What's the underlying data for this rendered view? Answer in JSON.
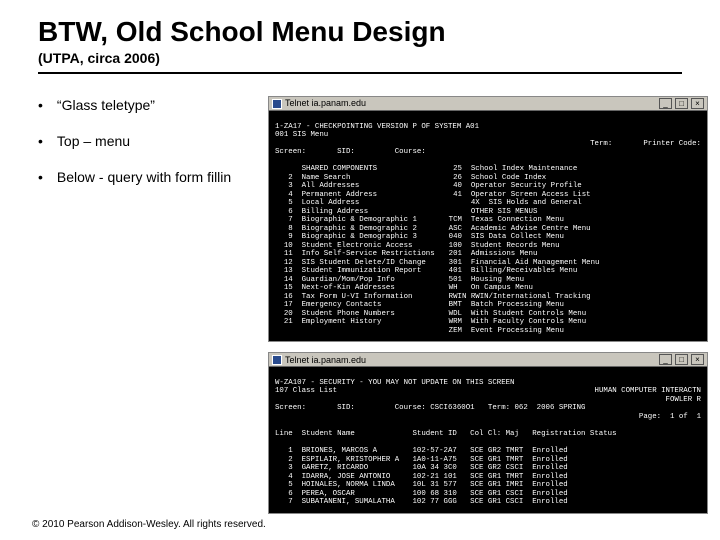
{
  "title": "BTW, Old School Menu Design",
  "subtitle": "(UTPA, circa 2006)",
  "bullets": [
    "“Glass teletype”",
    "Top – menu",
    "Below - query with form fillin"
  ],
  "telnet_title": "Telnet ia.panam.edu",
  "term1": {
    "line1": "1-ZA17 - CHECKPOINTING VERSION P OF SYSTEM A01",
    "line2": "001 SIS Menu",
    "line3r": "Term:       Printer Code:",
    "line4": "Screen:       SID:         Course:",
    "left_menu": "      SHARED COMPONENTS\n   2  Name Search\n   3  All Addresses\n   4  Permanent Address\n   5  Local Address\n   6  Billing Address\n   7  Biographic & Demographic 1\n   8  Biographic & Demographic 2\n   9  Biographic & Demographic 3\n  10  Student Electronic Access\n  11  Info Self-Service Restrictions\n  12  SIS Student Delete/ID Change\n  13  Student Immunization Report\n  14  Guardian/Mom/Pop Info\n  15  Next-of-Kin Addresses\n  16  Tax Form U-VI Information\n  17  Emergency Contacts\n  20  Student Phone Numbers\n  21  Employment History",
    "right_menu": " 25  School Index Maintenance\n 26  School Code Index\n 40  Operator Security Profile\n 41  Operator Screen Access List\n     4X  SIS Holds and General\n     OTHER SIS MENUS\nTCM  Texas Connection Menu\nASC  Academic Advise Centre Menu\n040  SIS Data Collect Menu\n100  Student Records Menu\n201  Admissions Menu\n301  Financial Aid Management Menu\n401  Billing/Receivables Menu\n501  Housing Menu\nWH   On Campus Menu\nRWIN RWIN/International Tracking\nBMT  Batch Processing Menu\nWDL  With Student Controls Menu\nWRM  With Faculty Controls Menu\nZEM  Event Processing Menu"
  },
  "term2": {
    "line1": "W-ZA107 - SECURITY - YOU MAY NOT UPDATE ON THIS SCREEN",
    "line2": "107 Class List",
    "line2r": "HUMAN COMPUTER INTERACTN",
    "line2r2": "FOWLER R",
    "line3": "Screen:       SID:         Course: CSCI6360O1   Term: 062  2006 SPRING",
    "line4r": "Page:  1 of  1",
    "cols": "Line  Student Name             Student ID   Col Cl: Maj   Registration Status",
    "rows": "   1  BRIONES, MARCOS A        102-57-2A7   SCE GR2 TMRT  Enrolled\n   2  ESPILAIR, KRISTOPHER A   1A0-11-A75   SCE GR1 TMRT  Enrolled\n   3  GARETZ, RICARDO          10A 34 3C0   SCE GR2 CSCI  Enrolled\n   4  IDARRA, JOSE ANTONIO     102-21 101   SCE GR1 TMRT  Enrolled\n   5  HOINALES, NORMA LINDA    10L 31 577   SCE GR1 IMRI  Enrolled\n   6  PEREA, OSCAR             100 68 310   SCE GR1 CSCI  Enrolled\n   7  SUBATANENI, SUMALATHA    102 77 GGG   SCE GR1 CSCI  Enrolled"
  },
  "footer": "© 2010 Pearson Addison-Wesley. All rights reserved."
}
